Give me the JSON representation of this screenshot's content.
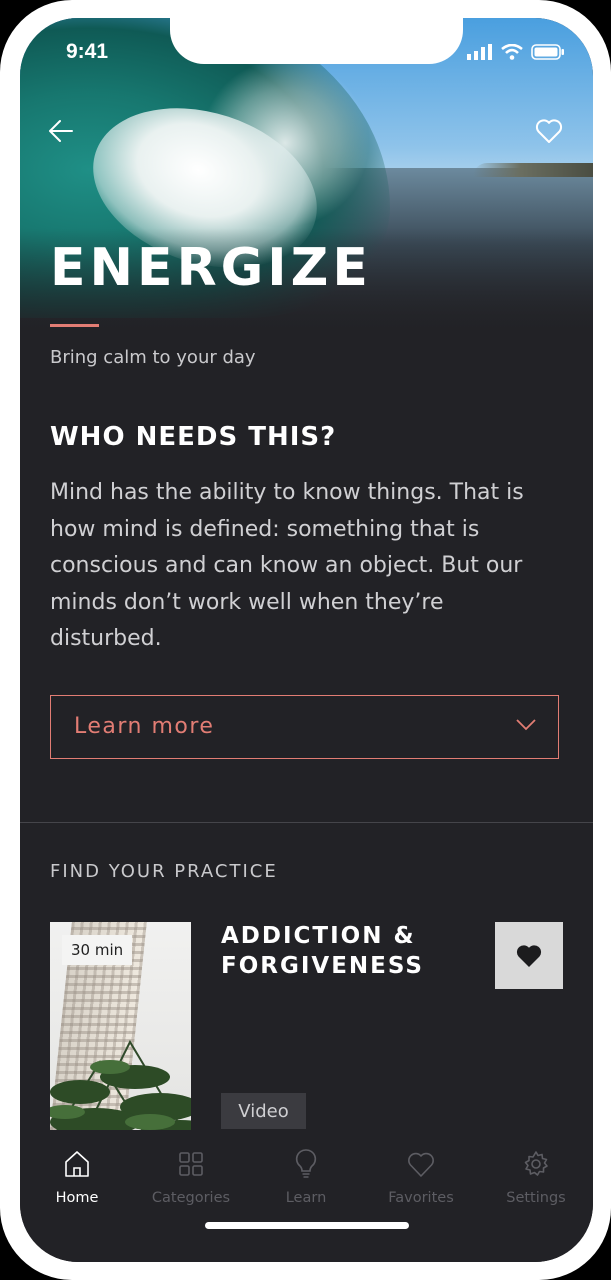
{
  "status_bar": {
    "time": "9:41"
  },
  "header": {
    "back_icon": "arrow-left-icon",
    "favorite_icon": "heart-outline-icon"
  },
  "hero": {
    "title": "ENERGIZE",
    "subtitle": "Bring calm to your day",
    "accent_color": "#e27d74"
  },
  "about": {
    "heading": "WHO NEEDS THIS?",
    "body": "Mind has the ability to know things. That is how mind is defined: something that is conscious and can know an object. But our minds don’t work well when they’re disturbed.",
    "learn_more_label": "Learn more"
  },
  "practice": {
    "section_label": "FIND YOUR PRACTICE",
    "items": [
      {
        "duration": "30 min",
        "title": "ADDICTION & FORGIVENESS",
        "type": "Video",
        "favorite_icon": "heart-filled-icon"
      }
    ]
  },
  "tabbar": {
    "tabs": [
      {
        "label": "Home",
        "icon": "home-icon",
        "active": true
      },
      {
        "label": "Categories",
        "icon": "grid-icon",
        "active": false
      },
      {
        "label": "Learn",
        "icon": "lightbulb-icon",
        "active": false
      },
      {
        "label": "Favorites",
        "icon": "heart-icon",
        "active": false
      },
      {
        "label": "Settings",
        "icon": "gear-icon",
        "active": false
      }
    ]
  },
  "colors": {
    "background": "#222226",
    "accent": "#e27d74",
    "inactive_tab": "#5d5d63"
  }
}
